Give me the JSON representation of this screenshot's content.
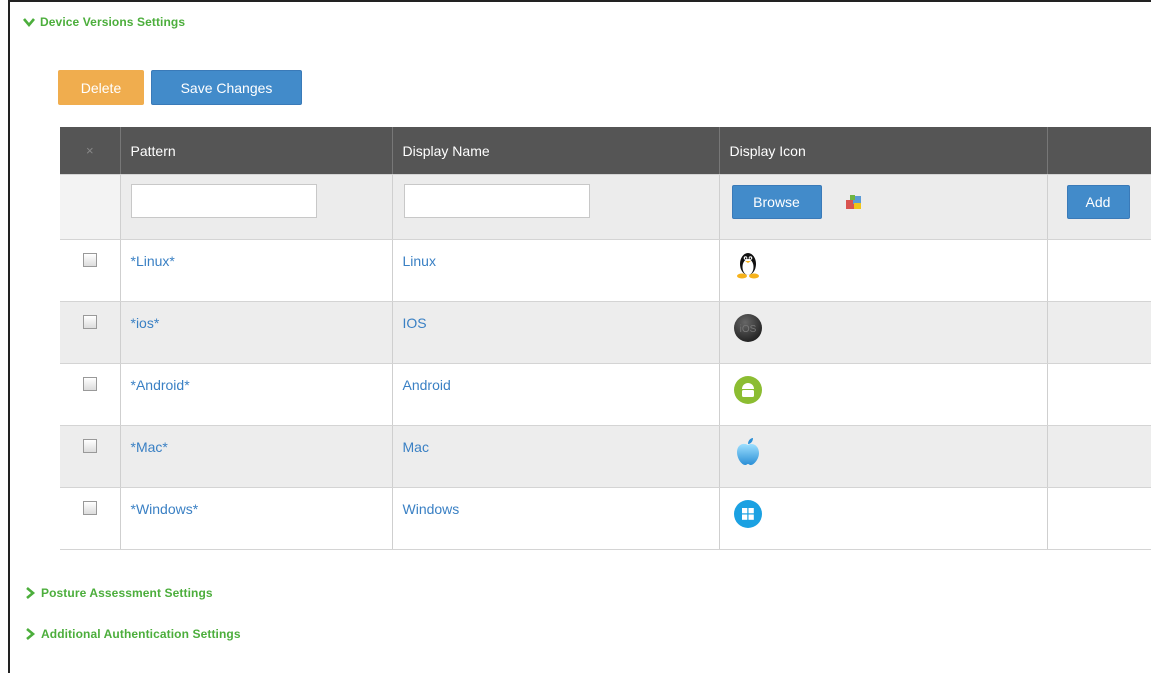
{
  "sections": {
    "device_versions": "Device Versions Settings",
    "posture": "Posture Assessment Settings",
    "additional_auth": "Additional Authentication Settings"
  },
  "toolbar": {
    "delete_label": "Delete",
    "save_label": "Save Changes"
  },
  "table": {
    "columns": [
      "×",
      "Pattern",
      "Display Name",
      "Display Icon",
      ""
    ],
    "input_row": {
      "pattern_value": "",
      "display_name_value": "",
      "browse_label": "Browse",
      "add_label": "Add"
    },
    "rows": [
      {
        "pattern": "*Linux*",
        "display_name": "Linux",
        "icon": "linux-penguin-icon",
        "checked": false
      },
      {
        "pattern": "*ios*",
        "display_name": "IOS",
        "icon": "ios-icon",
        "checked": false
      },
      {
        "pattern": "*Android*",
        "display_name": "Android",
        "icon": "android-icon",
        "checked": false
      },
      {
        "pattern": "*Mac*",
        "display_name": "Mac",
        "icon": "apple-icon",
        "checked": false
      },
      {
        "pattern": "*Windows*",
        "display_name": "Windows",
        "icon": "windows-icon",
        "checked": false
      }
    ]
  },
  "colors": {
    "section_green": "#4cae3c",
    "primary_blue": "#428bca",
    "warning_orange": "#f0ad4e",
    "header_gray": "#555555",
    "link_blue": "#3a80c4"
  }
}
